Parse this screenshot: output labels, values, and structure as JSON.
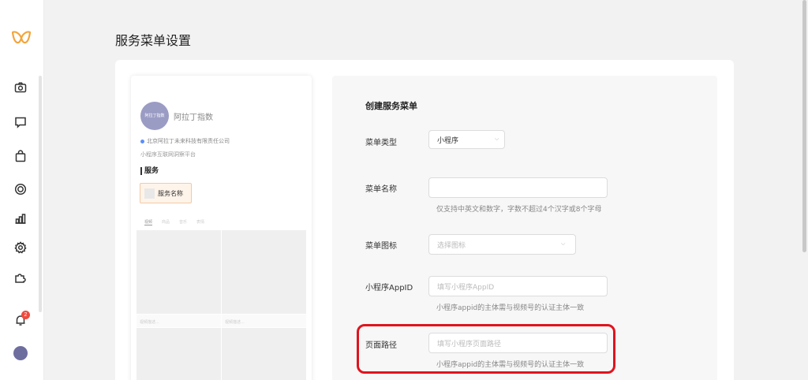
{
  "page": {
    "title": "服务菜单设置"
  },
  "sidebar": {
    "logo": "miniapp-logo",
    "items": [
      "camera-icon",
      "message-icon",
      "shopping-bag-icon",
      "target-icon",
      "chart-icon",
      "settings-icon",
      "plugin-icon"
    ],
    "notification_count": "2"
  },
  "preview": {
    "avatar_text": "阿拉丁指数",
    "account_name": "阿拉丁指数",
    "company": "北京阿拉丁未来科技有限责任公司",
    "subtitle": "小程序互联网洞察平台",
    "section_title": "服务",
    "service_button": "服务名称",
    "tabs": [
      "视频",
      "商品",
      "音乐",
      "表情"
    ],
    "captions": [
      "视频描述...",
      "视频描述..."
    ]
  },
  "form": {
    "title": "创建服务菜单",
    "menu_type": {
      "label": "菜单类型",
      "value": "小程序"
    },
    "menu_name": {
      "label": "菜单名称",
      "value": "",
      "help": "仅支持中英文和数字，字数不超过4个汉字或8个字母"
    },
    "menu_icon": {
      "label": "菜单图标",
      "placeholder": "选择图标"
    },
    "appid": {
      "label": "小程序AppID",
      "placeholder": "填写小程序AppID",
      "help": "小程序appid的主体需与视频号的认证主体一致"
    },
    "page_path": {
      "label": "页面路径",
      "placeholder": "填写小程序页面路径",
      "help": "小程序appid的主体需与视频号的认证主体一致"
    }
  },
  "colors": {
    "accent": "#e0141e",
    "badge": "#f04a3e",
    "logo": "#f3a43b"
  }
}
